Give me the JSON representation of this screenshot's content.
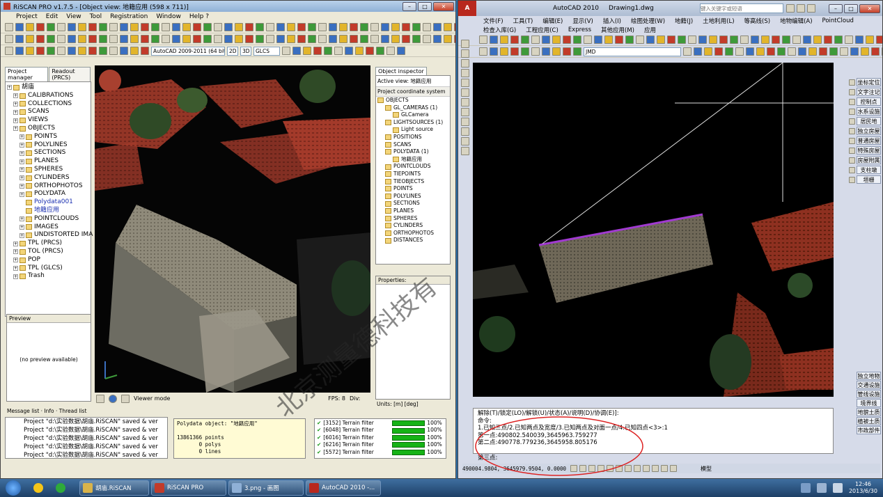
{
  "riscan": {
    "title": "RiSCAN PRO v1.7.5 - [Object view: 地籍应用 (598 x 711)]",
    "menu": [
      "Project",
      "Edit",
      "View",
      "Tool",
      "Registration",
      "Window",
      "Help ?"
    ],
    "combo_acad": "AutoCAD 2009-2011 (64 bit)",
    "btn_2d": "2D",
    "btn_3d": "3D",
    "combo_cs": "GLCS",
    "tab_project": "Project manager",
    "tab_readout": "Readout (PRCS)",
    "tree": [
      {
        "label": "胡庙",
        "level": 0
      },
      {
        "label": "CALIBRATIONS",
        "level": 1
      },
      {
        "label": "COLLECTIONS",
        "level": 1
      },
      {
        "label": "SCANS",
        "level": 1
      },
      {
        "label": "VIEWS",
        "level": 1
      },
      {
        "label": "OBJECTS",
        "level": 1
      },
      {
        "label": "POINTS",
        "level": 2
      },
      {
        "label": "POLYLINES",
        "level": 2
      },
      {
        "label": "SECTIONS",
        "level": 2
      },
      {
        "label": "PLANES",
        "level": 2
      },
      {
        "label": "SPHERES",
        "level": 2
      },
      {
        "label": "CYLINDERS",
        "level": 2
      },
      {
        "label": "ORTHOPHOTOS",
        "level": 2
      },
      {
        "label": "POLYDATA",
        "level": 2
      },
      {
        "label": "Polydata001",
        "level": 3,
        "blue": true
      },
      {
        "label": "地籍应用",
        "level": 3,
        "blue": true
      },
      {
        "label": "POINTCLOUDS",
        "level": 2
      },
      {
        "label": "IMAGES",
        "level": 2
      },
      {
        "label": "UNDISTORTED IMA",
        "level": 2
      },
      {
        "label": "TPL (PRCS)",
        "level": 1
      },
      {
        "label": "TOL (PRCS)",
        "level": 1
      },
      {
        "label": "POP",
        "level": 1
      },
      {
        "label": "TPL (GLCS)",
        "level": 1
      },
      {
        "label": "Trash",
        "level": 1
      }
    ],
    "preview_label": "Preview",
    "preview_empty": "(no preview available)",
    "viewer_mode": "Viewer mode",
    "fps": "FPS: 8",
    "div": "Div:",
    "inspector_tab": "Object inspector",
    "active_view": "Active view: 地籍应用",
    "coord_system": "Project coordinate system",
    "inspector_tree": [
      {
        "label": "OBJECTS",
        "level": 0
      },
      {
        "label": "GL_CAMERAS (1)",
        "level": 1
      },
      {
        "label": "GLCamera",
        "level": 2
      },
      {
        "label": "LIGHTSOURCES (1)",
        "level": 1
      },
      {
        "label": "Light source",
        "level": 2
      },
      {
        "label": "POSITIONS",
        "level": 1
      },
      {
        "label": "SCANS",
        "level": 1
      },
      {
        "label": "POLYDATA (1)",
        "level": 1
      },
      {
        "label": "地籍应用",
        "level": 2
      },
      {
        "label": "POINTCLOUDS",
        "level": 1
      },
      {
        "label": "TIEPOINTS",
        "level": 1
      },
      {
        "label": "TIEOBJECTS",
        "level": 1
      },
      {
        "label": "POINTS",
        "level": 1
      },
      {
        "label": "POLYLINES",
        "level": 1
      },
      {
        "label": "SECTIONS",
        "level": 1
      },
      {
        "label": "PLANES",
        "level": 1
      },
      {
        "label": "SPHERES",
        "level": 1
      },
      {
        "label": "CYLINDERS",
        "level": 1
      },
      {
        "label": "ORTHOPHOTOS",
        "level": 1
      },
      {
        "label": "DISTANCES",
        "level": 1
      }
    ],
    "properties": "Properties:",
    "units": "Units: [m] [deg]",
    "msg_tabs": "Message list · Info · Thread list",
    "messages": [
      "Project \"d:\\实验数据\\胡庙.RiSCAN\" saved & ver",
      "Project \"d:\\实验数据\\胡庙.RiSCAN\" saved & ver",
      "Project \"d:\\实验数据\\胡庙.RiSCAN\" saved & ver",
      "Project \"d:\\实验数据\\胡庙.RiSCAN\" saved & ver",
      "Project \"d:\\实验数据\\胡庙.RiSCAN\" saved & ver"
    ],
    "info": [
      "Polydata object: \"地籍应用\"",
      "",
      "13861366 points",
      "       0 polys",
      "       0 lines"
    ],
    "threads": [
      {
        "id": "[3152] Terrain filter",
        "pct": "100%"
      },
      {
        "id": "[6048] Terrain filter",
        "pct": "100%"
      },
      {
        "id": "[6016] Terrain filter",
        "pct": "100%"
      },
      {
        "id": "[6216] Terrain filter",
        "pct": "100%"
      },
      {
        "id": "[5572] Terrain filter",
        "pct": "100%"
      }
    ]
  },
  "acad": {
    "app": "AutoCAD 2010",
    "doc": "Drawing1.dwg",
    "search_placeholder": "键入关键字或短语",
    "menu1": [
      "文件(F)",
      "工具(T)",
      "编辑(E)",
      "显示(V)",
      "插入(I)",
      "绘图处理(W)",
      "地籍(J)",
      "土地利用(L)",
      "等高线(S)",
      "地物编辑(A)",
      "PointCloud"
    ],
    "menu2": [
      "检查入库(G)",
      "工程应用(C)",
      "Express",
      "其他应用(M)",
      "应用"
    ],
    "layer": "JMD",
    "right_panel": [
      "坐标定位",
      "文字注记",
      "控制点",
      "水系设施",
      "居民地",
      "独立房屋",
      "普通房屋",
      "特殊房屋",
      "房屋附属",
      "支柱墩",
      "垣栅"
    ],
    "right_panel_bottom": [
      "独立地物",
      "交通设施",
      "管线设施",
      "境界线",
      "地貌土质",
      "植被土质",
      "市政部件"
    ],
    "cmd": [
      "解除(T)/锁定(LO)/解锁(U)/状态(A)/说明(D)/协调(E)]:",
      "命令:",
      "1.已知三点/2.已知两点及宽度/3.已知两点及对面一点/4.已知四点<3>:1",
      "第一点:490802.540039,3645963.759277",
      "第二点:490778.779236,3645958.805176"
    ],
    "prompt": "第三点:",
    "coords": "490004.9804, 3645979.9504, 0.0000",
    "model": "模型"
  },
  "watermark": "北京测量德科技有",
  "taskbar": {
    "items": [
      "胡庙.RiSCAN",
      "RiSCAN PRO",
      "3.png - 画图",
      "AutoCAD 2010 -..."
    ],
    "time": "12:46",
    "date": "2013/6/30"
  }
}
